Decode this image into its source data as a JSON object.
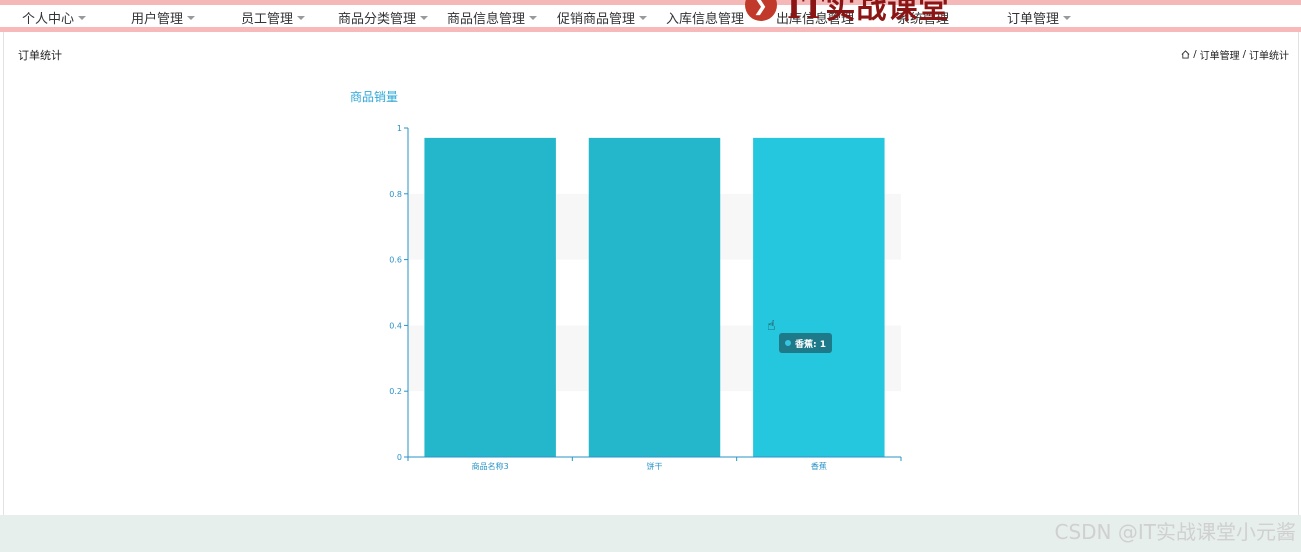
{
  "nav": {
    "items": [
      {
        "label": "个人中心"
      },
      {
        "label": "用户管理"
      },
      {
        "label": "员工管理"
      },
      {
        "label": "商品分类管理"
      },
      {
        "label": "商品信息管理"
      },
      {
        "label": "促销商品管理"
      },
      {
        "label": "入库信息管理"
      },
      {
        "label": "出库信息管理"
      },
      {
        "label": "系统管理"
      },
      {
        "label": "订单管理"
      }
    ]
  },
  "watermark_logo": {
    "text": "IT实战课堂"
  },
  "page": {
    "title": "订单统计",
    "breadcrumb": [
      "订单管理",
      "订单统计"
    ],
    "separator": "/"
  },
  "chart_data": {
    "type": "bar",
    "title": "商品销量",
    "categories": [
      "商品名称3",
      "饼干",
      "香蕉"
    ],
    "values": [
      1,
      1,
      1
    ],
    "ylim": [
      0,
      1
    ],
    "yticks": [
      "0",
      "0.2",
      "0.4",
      "0.6",
      "0.8",
      "1"
    ],
    "colors": [
      "#24b7cb",
      "#24b7cb",
      "#25c7de"
    ],
    "axis_color": "#2a93c9",
    "grid": "horizontal bands"
  },
  "tooltip": {
    "text": "香蕉: 1"
  },
  "csdn_watermark": "CSDN @IT实战课堂小元酱"
}
